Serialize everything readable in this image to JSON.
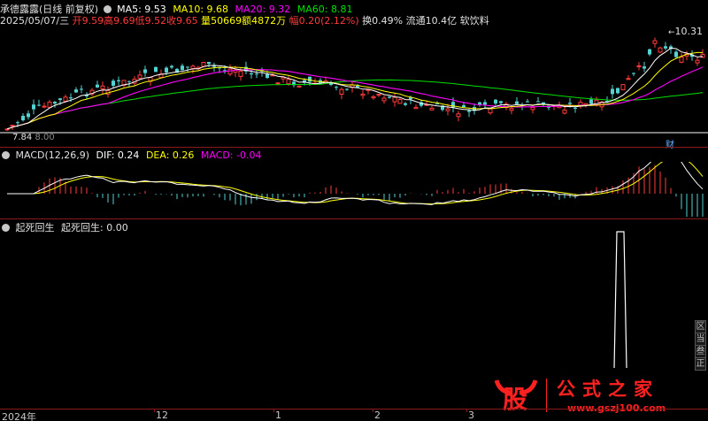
{
  "header": {
    "stock_name": "承德露露",
    "period_mode": "(日线 前复权)",
    "ma5": "MA5: 9.53",
    "ma10": "MA10: 9.68",
    "ma20": "MA20: 9.32",
    "ma60": "MA60: 8.81",
    "date": "2025/05/07/三",
    "open": "开9.59",
    "high": "高9.69",
    "low": "低9.52",
    "close": "收9.65",
    "volume": "量50669",
    "amount": "额4872万",
    "change": "幅0.20(2.12%)",
    "turnover": "换0.49%",
    "float_cap": "流通10.4亿",
    "industry": "软饮料"
  },
  "main_chart": {
    "high_label": "10.31",
    "low_label": "7.84",
    "low_label_partial": "8.00",
    "finance_marker": "财"
  },
  "macd": {
    "title": "MACD(12,26,9)",
    "dif": "DIF: 0.24",
    "dea": "DEA: 0.26",
    "macd": "MACD: -0.04"
  },
  "qisi": {
    "title": "起死回生",
    "series_label": "起死回生:",
    "value": "0.00"
  },
  "date_axis": {
    "labels": [
      "2024年",
      "12",
      "1",
      "2",
      "3"
    ]
  },
  "side_buttons": [
    "区",
    "当",
    "叁",
    "正"
  ],
  "watermark": {
    "logo_char": "股",
    "site_name": "公式之家",
    "url": "www.gszj100.com"
  },
  "colors": {
    "up": "#ff3b3b",
    "down": "#54d2d2",
    "ma5": "#ffffff",
    "ma10": "#ffff00",
    "ma20": "#ff00ff",
    "ma60": "#00e000",
    "accent_red": "#ff2020"
  }
}
